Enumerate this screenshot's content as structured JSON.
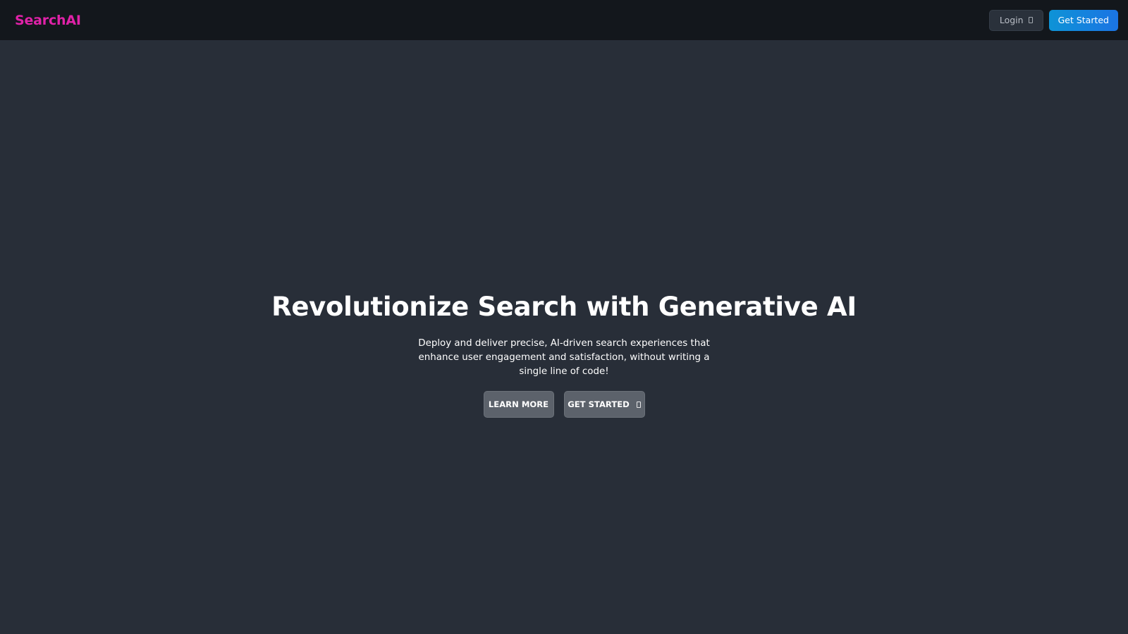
{
  "navbar": {
    "brand": "SearchAI",
    "login_label": "Login",
    "get_started_label": "Get Started"
  },
  "hero": {
    "title": "Revolutionize Search with Generative AI",
    "subtitle": "Deploy and deliver precise, AI-driven search experiences that enhance user engagement and satisfaction, without writing a single line of code!",
    "learn_more_label": "LEARN MORE",
    "get_started_label": "GET STARTED"
  },
  "colors": {
    "brand": "#e022a8",
    "navbar_bg": "#13171c",
    "page_bg": "#282e38",
    "primary_gradient_start": "#0e93d6",
    "primary_gradient_end": "#1b74e4",
    "hero_button_bg": "#5c626b"
  },
  "icons": {
    "login": "login-icon",
    "get_started_hero": "arrow-icon"
  }
}
